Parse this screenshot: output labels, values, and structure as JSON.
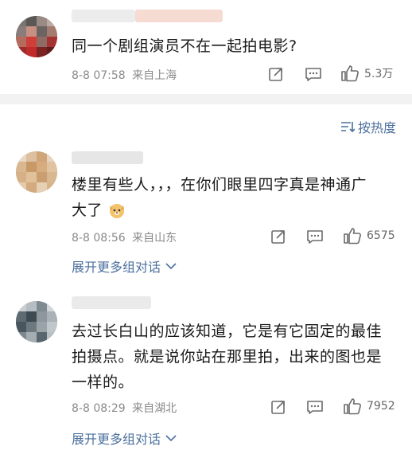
{
  "posts": [
    {
      "text": "同一个剧组演员不在一起拍电影?",
      "time": "8-8 07:58",
      "location": "来自上海",
      "likes": "5.3万"
    },
    {
      "text_line1": "楼里有些人，，，在你们眼里四字真是神通广",
      "text_line2": "大了",
      "time": "8-8 08:56",
      "location": "来自山东",
      "likes": "6575",
      "more": "展开更多组对话"
    },
    {
      "text_line1": "去过长白山的应该知道，它是有它固定的最佳",
      "text_line2": "拍摄点。就是说你站在那里拍，出来的图也是",
      "text_line3": "一样的。",
      "time": "8-8 08:29",
      "location": "来自湖北",
      "likes": "7952",
      "more": "展开更多组对话"
    }
  ],
  "sort": {
    "label": "按热度"
  },
  "icons": [
    "share-icon",
    "comment-icon",
    "like-icon",
    "sort-icon",
    "chevron-down-icon",
    "emoji-dog-icon"
  ],
  "colors": {
    "link": "#4b6f9e",
    "meta": "#8a8a8a",
    "divider": "#f2f2f2"
  }
}
